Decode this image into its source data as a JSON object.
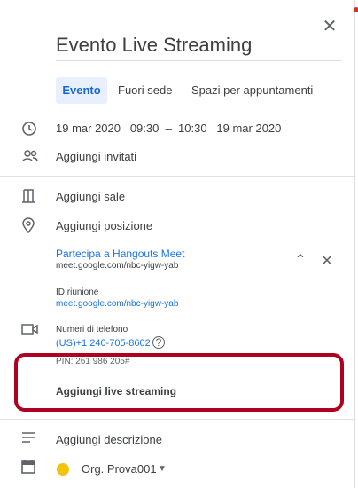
{
  "header": {
    "close_icon": "close-icon",
    "title": "Evento Live Streaming"
  },
  "tabs": [
    {
      "label": "Evento",
      "active": true
    },
    {
      "label": "Fuori sede",
      "active": false
    },
    {
      "label": "Spazi per appuntamenti",
      "active": false
    }
  ],
  "details": {
    "datetime": "19 mar 2020   09:30  –  10:30   19 mar 2020",
    "add_guests": "Aggiungi invitati",
    "add_rooms": "Aggiungi sale",
    "add_location": "Aggiungi posizione"
  },
  "meet": {
    "join_label": "Partecipa a Hangouts Meet",
    "join_url": "meet.google.com/nbc-yigw-yab",
    "meeting_id_label": "ID riunione",
    "meeting_id_url": "meet.google.com/nbc-yigw-yab",
    "phone_label": "Numeri di telefono",
    "phone_number": "(US)+1 240-705-8602",
    "pin": "PIN: 261 986 205#",
    "add_live_streaming": "Aggiungi live streaming"
  },
  "footer": {
    "add_description": "Aggiungi descrizione",
    "calendar_name": "Org. Prova001"
  },
  "colors": {
    "accent": "#1a73e8",
    "tab_bg": "#e8f0fe",
    "highlight": "#b00020",
    "calendar_dot": "#f4c20d"
  }
}
